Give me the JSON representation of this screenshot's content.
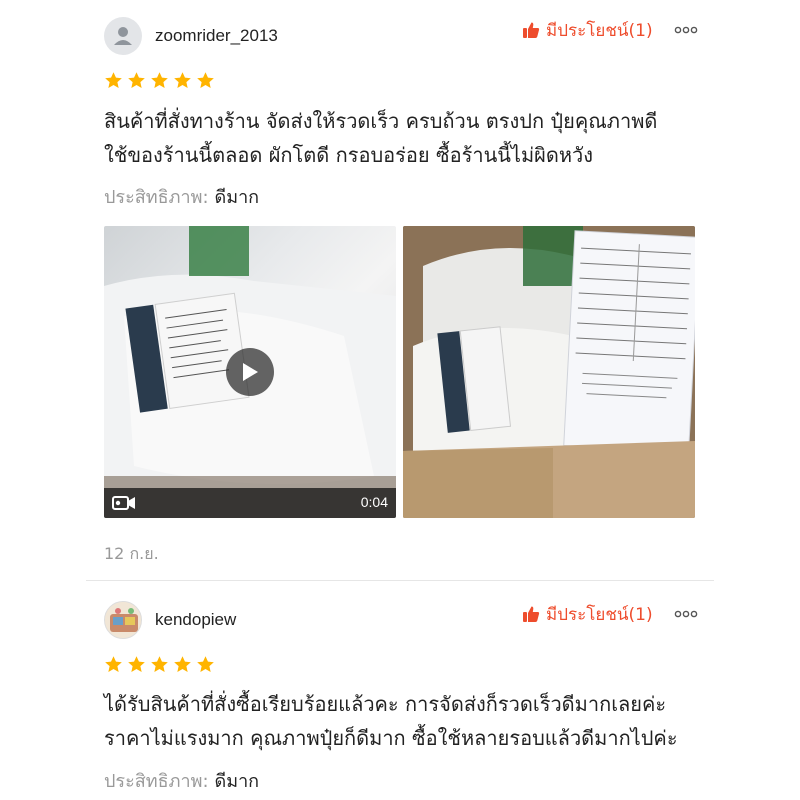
{
  "reviews": [
    {
      "username": "zoomrider_2013",
      "helpful_label": "มีประโยชน์(1)",
      "rating": 5,
      "body_lines": [
        "สินค้าที่สั่งทางร้าน จัดส่งให้รวดเร็ว ครบถ้วน ตรงปก ปุ๋ยคุณภาพดี",
        "ใช้ของร้านนี้ตลอด ผักโตดี กรอบอร่อย ซื้อร้านนี้ไม่ผิดหวัง"
      ],
      "attribute_label": "ประสิทธิภาพ:",
      "attribute_value": "ดีมาก",
      "video_duration": "0:04",
      "date": "12 ก.ย."
    },
    {
      "username": "kendopiew",
      "helpful_label": "มีประโยชน์(1)",
      "rating": 5,
      "body_lines": [
        "ได้รับสินค้าที่สั่งซื้อเรียบร้อยแล้วคะ การจัดส่งก็รวดเร็วดีมากเลยค่ะ",
        "ราคาไม่แรงมาก คุณภาพปุ๋ยก็ดีมาก ซื้อใช้หลายรอบแล้วดีมากไปค่ะ"
      ],
      "attribute_label": "ประสิทธิภาพ:",
      "attribute_value": "ดีมาก"
    }
  ],
  "colors": {
    "accent": "#ee4d2d",
    "star": "#ffb400",
    "muted_text": "#999999",
    "divider": "#e6e6e6"
  },
  "icons": {
    "avatar_default": "default-avatar-icon",
    "helpful": "thumbs-up-icon",
    "more": "more-dots-icon",
    "star": "star-icon",
    "play": "play-icon",
    "video": "video-camera-icon"
  }
}
